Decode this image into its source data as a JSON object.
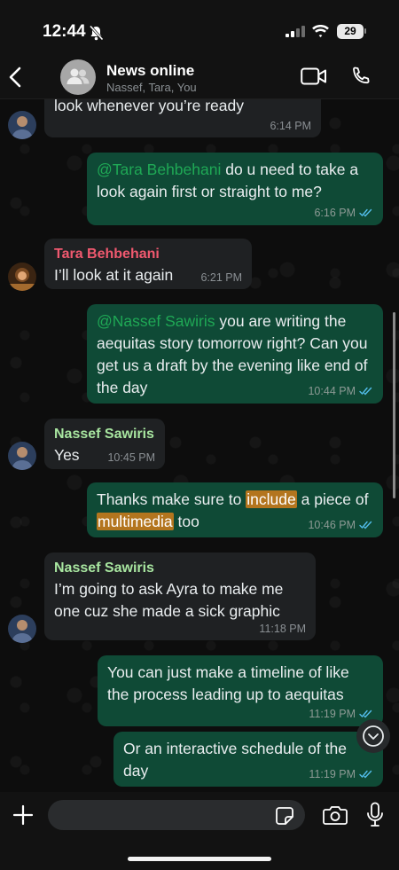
{
  "status_bar": {
    "time": "12:44",
    "battery": "29"
  },
  "header": {
    "title": "News online",
    "subtitle": "Nassef, Tara, You"
  },
  "messages": [
    {
      "text": "look whenever you’re ready",
      "time": "6:14 PM"
    },
    {
      "mention": "@Tara Behbehani",
      "text": " do u need to take a look again first or straight to me?",
      "time": "6:16 PM"
    },
    {
      "sender": "Tara Behbehani",
      "text": "I’ll look at it again",
      "time": "6:21 PM"
    },
    {
      "mention": "@Nassef Sawiris",
      "text": " you are writing the aequitas story tomorrow right? Can you get us a draft by the evening like end of the day",
      "time": "10:44 PM"
    },
    {
      "sender": "Nassef Sawiris",
      "text": "Yes",
      "time": "10:45 PM"
    },
    {
      "text_a": "Thanks make sure to ",
      "highlight_1": "include",
      "text_b": " a piece of ",
      "highlight_2": "multimedia",
      "text_c": " too",
      "time": "10:46 PM"
    },
    {
      "sender": "Nassef Sawiris",
      "text": "I’m going to ask Ayra to make me one cuz she made a sick graphic",
      "time": "11:18 PM"
    },
    {
      "text": "You can just make a timeline of like the process leading up to aequitas",
      "time": "11:19 PM"
    },
    {
      "text": "Or an interactive schedule of the day",
      "time": "11:19 PM"
    }
  ],
  "colors": {
    "outgoing_bubble": "#0f4a36",
    "incoming_bubble": "#1f2123",
    "tara_name": "#f0596f",
    "nassef_name": "#a8e6a0",
    "mention": "#1fa855",
    "highlight": "#b3751e",
    "read_ticks": "#53bdeb"
  },
  "input": {
    "placeholder": ""
  },
  "icons": [
    "back-chevron-icon",
    "group-avatar-icon",
    "video-call-icon",
    "phone-icon",
    "plus-icon",
    "sticker-icon",
    "camera-icon",
    "microphone-icon",
    "scroll-down-icon",
    "read-receipt-icon"
  ]
}
